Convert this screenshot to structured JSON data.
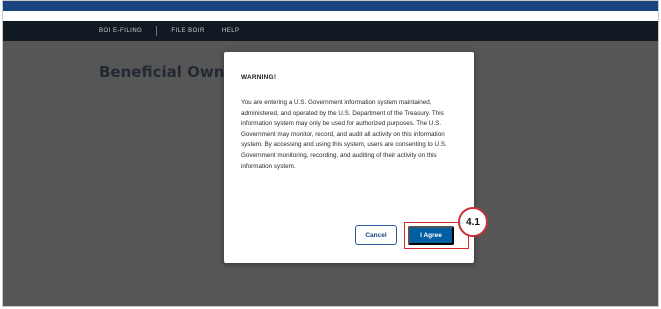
{
  "nav": {
    "items": [
      "BOI E-FILING",
      "FILE BOIR",
      "HELP"
    ]
  },
  "page": {
    "title": "Beneficial Owner"
  },
  "modal": {
    "heading": "WARNING!",
    "body": "You are entering a U.S. Government information system maintained, administered, and operated by the U.S. Department of the Treasury. This information system may only be used for authorized purposes. The U.S. Government may monitor, record, and audit all activity on this information system. By accessing and using this system, users are consenting to U.S. Government monitoring, recording, and auditing of their activity on this information system.",
    "cancel_label": "Cancel",
    "agree_label": "I Agree"
  },
  "annotation": {
    "step_label": "4.1"
  },
  "colors": {
    "header_stripe": "#1a4480",
    "navbar_bg": "#111a22",
    "agree_button": "#005ea2",
    "highlight": "#d9272e"
  }
}
